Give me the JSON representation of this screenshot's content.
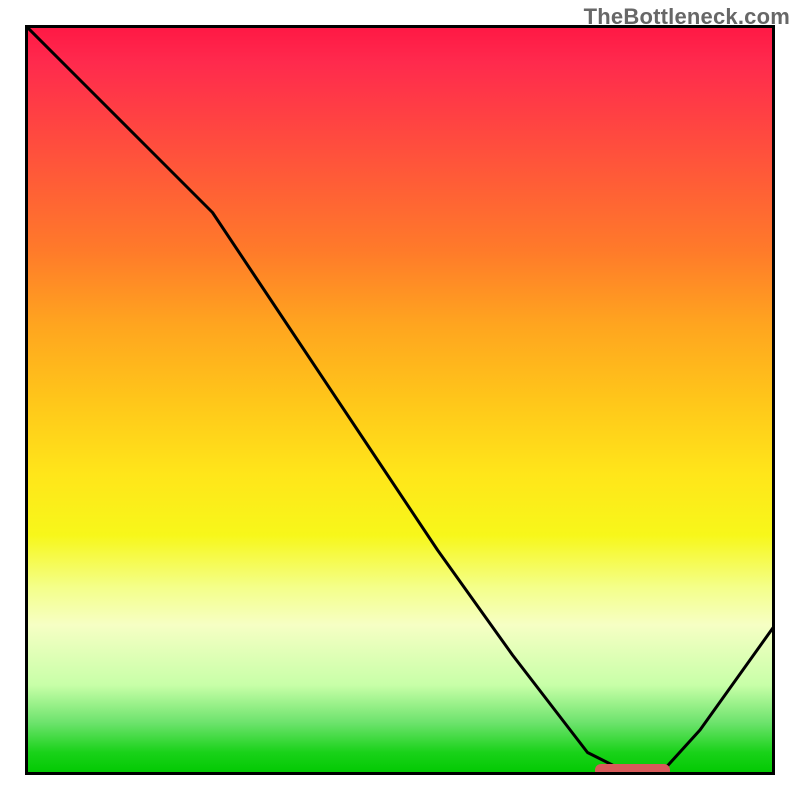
{
  "watermark": "TheBottleneck.com",
  "colors": {
    "gradient_top": "#ff1744",
    "gradient_bottom": "#00c800",
    "curve": "#000000",
    "marker": "#d85a5a"
  },
  "chart_data": {
    "type": "line",
    "title": "",
    "xlabel": "",
    "ylabel": "",
    "xlim": [
      0,
      100
    ],
    "ylim": [
      0,
      100
    ],
    "grid": false,
    "legend": false,
    "series": [
      {
        "name": "bottleneck-curve",
        "x": [
          0,
          8,
          16,
          25,
          35,
          45,
          55,
          65,
          75,
          80,
          85,
          90,
          100
        ],
        "y": [
          100,
          92,
          84,
          75,
          60,
          45,
          30,
          16,
          3,
          0.5,
          0.5,
          6,
          20
        ]
      }
    ],
    "annotations": [
      {
        "name": "optimal-marker",
        "shape": "rounded-bar",
        "x_start": 76,
        "x_end": 86,
        "y": 0.6,
        "color": "#d85a5a"
      }
    ]
  }
}
